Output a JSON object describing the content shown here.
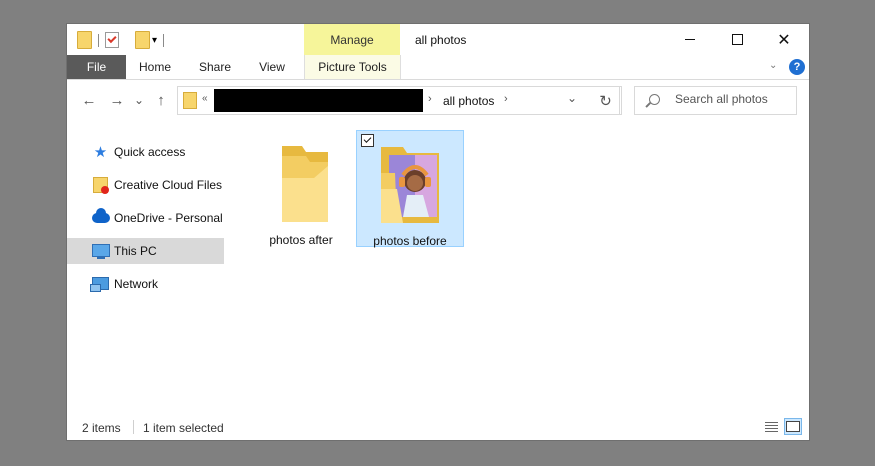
{
  "window": {
    "title": "all photos",
    "contextual_tab_group": "Manage",
    "controls": {
      "minimize": "minimize-icon",
      "maximize": "maximize-icon",
      "close": "✕"
    }
  },
  "quick_access_toolbar": {
    "icons": [
      "folder-icon",
      "properties-icon",
      "new-folder-icon",
      "customize-dropdown-icon"
    ]
  },
  "ribbon": {
    "tabs": [
      "File",
      "Home",
      "Share",
      "View",
      "Picture Tools"
    ],
    "help_label": "?"
  },
  "navigation": {
    "back_icon": "←",
    "forward_icon": "→",
    "recent_icon": "⌄",
    "up_icon": "↑",
    "address": {
      "overflow_label": "«",
      "separator": "›",
      "crumb": "all photos",
      "dropdown_icon": "⌄"
    },
    "refresh_icon": "↻",
    "search_placeholder": "Search all photos"
  },
  "sidebar": {
    "items": [
      {
        "label": "Quick access",
        "icon": "star-icon"
      },
      {
        "label": "Creative Cloud Files",
        "icon": "creative-cloud-folder-icon"
      },
      {
        "label": "OneDrive - Personal",
        "icon": "onedrive-cloud-icon"
      },
      {
        "label": "This PC",
        "icon": "computer-icon",
        "selected": true
      },
      {
        "label": "Network",
        "icon": "network-icon"
      }
    ]
  },
  "files": [
    {
      "name": "photos after",
      "type": "folder",
      "selected": false
    },
    {
      "name": "photos before",
      "type": "folder-with-thumbnail",
      "selected": true
    }
  ],
  "status": {
    "item_count": "2 items",
    "selection": "1 item selected",
    "active_view": "large-icons"
  },
  "colors": {
    "selection_bg": "#cce8ff",
    "selection_border": "#99d1ff",
    "manage_tab": "#f6f59a",
    "file_tab": "#5a5a5a",
    "folder": "#f7d56c"
  }
}
